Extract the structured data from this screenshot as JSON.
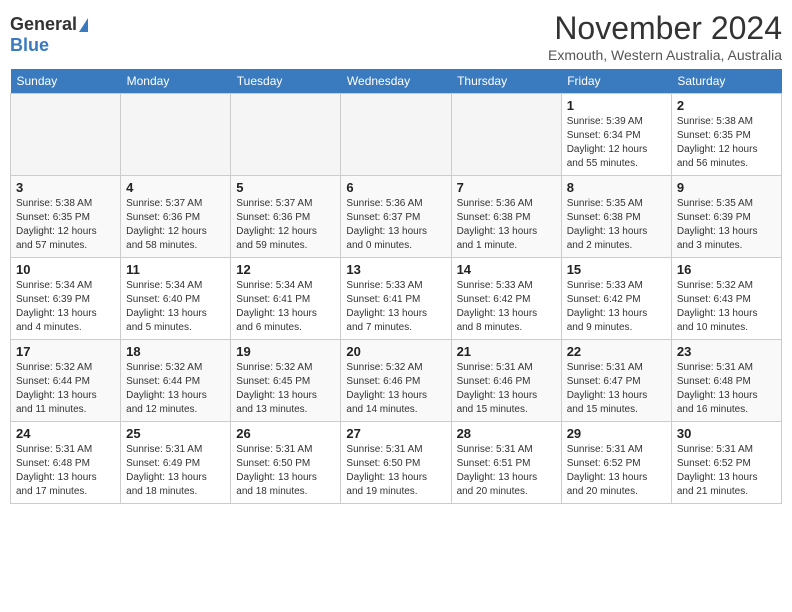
{
  "header": {
    "logo_general": "General",
    "logo_blue": "Blue",
    "month_title": "November 2024",
    "location": "Exmouth, Western Australia, Australia"
  },
  "weekdays": [
    "Sunday",
    "Monday",
    "Tuesday",
    "Wednesday",
    "Thursday",
    "Friday",
    "Saturday"
  ],
  "weeks": [
    [
      {
        "day": "",
        "empty": true
      },
      {
        "day": "",
        "empty": true
      },
      {
        "day": "",
        "empty": true
      },
      {
        "day": "",
        "empty": true
      },
      {
        "day": "",
        "empty": true
      },
      {
        "day": "1",
        "sunrise": "5:39 AM",
        "sunset": "6:34 PM",
        "daylight": "12 hours and 55 minutes."
      },
      {
        "day": "2",
        "sunrise": "5:38 AM",
        "sunset": "6:35 PM",
        "daylight": "12 hours and 56 minutes."
      }
    ],
    [
      {
        "day": "3",
        "sunrise": "5:38 AM",
        "sunset": "6:35 PM",
        "daylight": "12 hours and 57 minutes."
      },
      {
        "day": "4",
        "sunrise": "5:37 AM",
        "sunset": "6:36 PM",
        "daylight": "12 hours and 58 minutes."
      },
      {
        "day": "5",
        "sunrise": "5:37 AM",
        "sunset": "6:36 PM",
        "daylight": "12 hours and 59 minutes."
      },
      {
        "day": "6",
        "sunrise": "5:36 AM",
        "sunset": "6:37 PM",
        "daylight": "13 hours and 0 minutes."
      },
      {
        "day": "7",
        "sunrise": "5:36 AM",
        "sunset": "6:38 PM",
        "daylight": "13 hours and 1 minute."
      },
      {
        "day": "8",
        "sunrise": "5:35 AM",
        "sunset": "6:38 PM",
        "daylight": "13 hours and 2 minutes."
      },
      {
        "day": "9",
        "sunrise": "5:35 AM",
        "sunset": "6:39 PM",
        "daylight": "13 hours and 3 minutes."
      }
    ],
    [
      {
        "day": "10",
        "sunrise": "5:34 AM",
        "sunset": "6:39 PM",
        "daylight": "13 hours and 4 minutes."
      },
      {
        "day": "11",
        "sunrise": "5:34 AM",
        "sunset": "6:40 PM",
        "daylight": "13 hours and 5 minutes."
      },
      {
        "day": "12",
        "sunrise": "5:34 AM",
        "sunset": "6:41 PM",
        "daylight": "13 hours and 6 minutes."
      },
      {
        "day": "13",
        "sunrise": "5:33 AM",
        "sunset": "6:41 PM",
        "daylight": "13 hours and 7 minutes."
      },
      {
        "day": "14",
        "sunrise": "5:33 AM",
        "sunset": "6:42 PM",
        "daylight": "13 hours and 8 minutes."
      },
      {
        "day": "15",
        "sunrise": "5:33 AM",
        "sunset": "6:42 PM",
        "daylight": "13 hours and 9 minutes."
      },
      {
        "day": "16",
        "sunrise": "5:32 AM",
        "sunset": "6:43 PM",
        "daylight": "13 hours and 10 minutes."
      }
    ],
    [
      {
        "day": "17",
        "sunrise": "5:32 AM",
        "sunset": "6:44 PM",
        "daylight": "13 hours and 11 minutes."
      },
      {
        "day": "18",
        "sunrise": "5:32 AM",
        "sunset": "6:44 PM",
        "daylight": "13 hours and 12 minutes."
      },
      {
        "day": "19",
        "sunrise": "5:32 AM",
        "sunset": "6:45 PM",
        "daylight": "13 hours and 13 minutes."
      },
      {
        "day": "20",
        "sunrise": "5:32 AM",
        "sunset": "6:46 PM",
        "daylight": "13 hours and 14 minutes."
      },
      {
        "day": "21",
        "sunrise": "5:31 AM",
        "sunset": "6:46 PM",
        "daylight": "13 hours and 15 minutes."
      },
      {
        "day": "22",
        "sunrise": "5:31 AM",
        "sunset": "6:47 PM",
        "daylight": "13 hours and 15 minutes."
      },
      {
        "day": "23",
        "sunrise": "5:31 AM",
        "sunset": "6:48 PM",
        "daylight": "13 hours and 16 minutes."
      }
    ],
    [
      {
        "day": "24",
        "sunrise": "5:31 AM",
        "sunset": "6:48 PM",
        "daylight": "13 hours and 17 minutes."
      },
      {
        "day": "25",
        "sunrise": "5:31 AM",
        "sunset": "6:49 PM",
        "daylight": "13 hours and 18 minutes."
      },
      {
        "day": "26",
        "sunrise": "5:31 AM",
        "sunset": "6:50 PM",
        "daylight": "13 hours and 18 minutes."
      },
      {
        "day": "27",
        "sunrise": "5:31 AM",
        "sunset": "6:50 PM",
        "daylight": "13 hours and 19 minutes."
      },
      {
        "day": "28",
        "sunrise": "5:31 AM",
        "sunset": "6:51 PM",
        "daylight": "13 hours and 20 minutes."
      },
      {
        "day": "29",
        "sunrise": "5:31 AM",
        "sunset": "6:52 PM",
        "daylight": "13 hours and 20 minutes."
      },
      {
        "day": "30",
        "sunrise": "5:31 AM",
        "sunset": "6:52 PM",
        "daylight": "13 hours and 21 minutes."
      }
    ]
  ]
}
